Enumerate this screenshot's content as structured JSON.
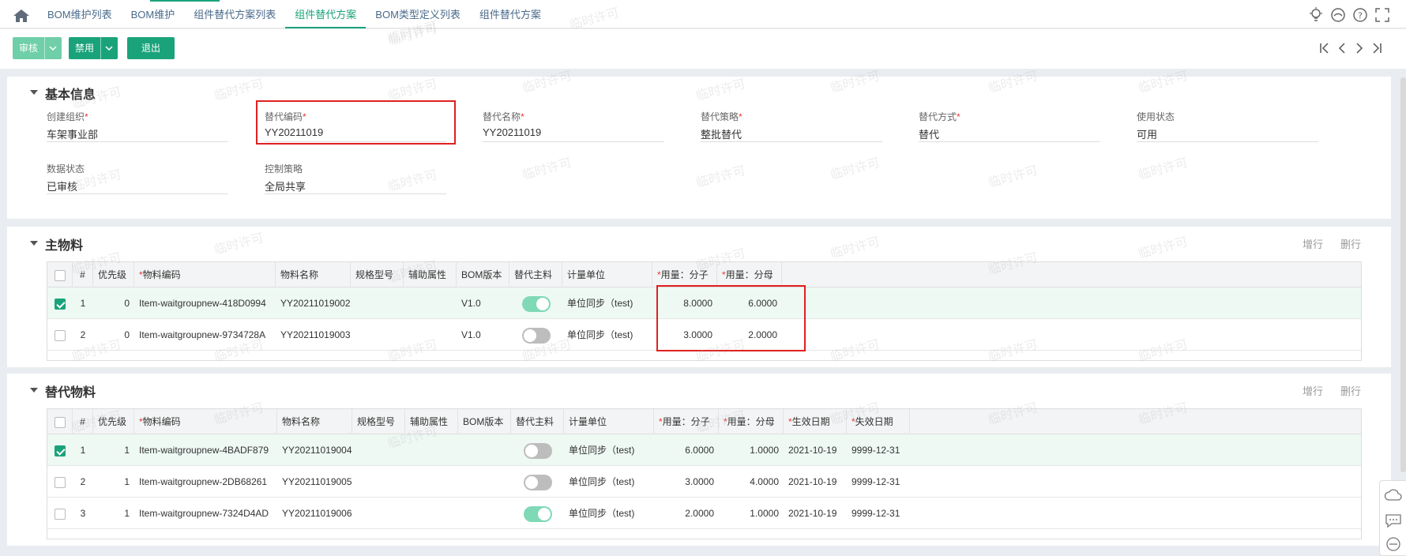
{
  "tabs": [
    {
      "label": "BOM维护列表",
      "active": false
    },
    {
      "label": "BOM维护",
      "active": false
    },
    {
      "label": "组件替代方案列表",
      "active": false
    },
    {
      "label": "组件替代方案",
      "active": true
    },
    {
      "label": "BOM类型定义列表",
      "active": false
    },
    {
      "label": "组件替代方案",
      "active": false
    }
  ],
  "toolbar": {
    "approve": "审核",
    "disable": "禁用",
    "exit": "退出"
  },
  "basic": {
    "title": "基本信息",
    "fields": [
      {
        "label": "创建组织",
        "required": true,
        "value": "车架事业部"
      },
      {
        "label": "替代编码",
        "required": true,
        "value": "YY20211019"
      },
      {
        "label": "替代名称",
        "required": true,
        "value": "YY20211019"
      },
      {
        "label": "替代策略",
        "required": true,
        "value": "整批替代"
      },
      {
        "label": "替代方式",
        "required": true,
        "value": "替代"
      },
      {
        "label": "使用状态",
        "required": false,
        "value": "可用"
      },
      {
        "label": "数据状态",
        "required": false,
        "value": "已审核"
      },
      {
        "label": "控制策略",
        "required": false,
        "value": "全局共享"
      }
    ]
  },
  "main": {
    "title": "主物料",
    "add_row": "增行",
    "del_row": "删行",
    "columns": {
      "no": "#",
      "priority": "优先级",
      "code": "物料编码",
      "name": "物料名称",
      "spec": "规格型号",
      "attr": "辅助属性",
      "bom": "BOM版本",
      "primary": "替代主料",
      "unit": "计量单位",
      "num": "用量：分子",
      "den": "用量：分母"
    },
    "rows": [
      {
        "checked": true,
        "no": "1",
        "priority": "0",
        "code": "Item-waitgroupnew-418D0994",
        "name": "YY20211019002",
        "spec": "",
        "attr": "",
        "bom": "V1.0",
        "primary": true,
        "unit": "单位同步（test)",
        "num": "8.0000",
        "den": "6.0000"
      },
      {
        "checked": false,
        "no": "2",
        "priority": "0",
        "code": "Item-waitgroupnew-9734728A",
        "name": "YY20211019003",
        "spec": "",
        "attr": "",
        "bom": "V1.0",
        "primary": false,
        "unit": "单位同步（test)",
        "num": "3.0000",
        "den": "2.0000"
      }
    ]
  },
  "sub": {
    "title": "替代物料",
    "add_row": "增行",
    "del_row": "删行",
    "columns": {
      "no": "#",
      "priority": "优先级",
      "code": "物料编码",
      "name": "物料名称",
      "spec": "规格型号",
      "attr": "辅助属性",
      "bom": "BOM版本",
      "primary": "替代主料",
      "unit": "计量单位",
      "num": "用量：分子",
      "den": "用量：分母",
      "start": "生效日期",
      "end": "失效日期"
    },
    "rows": [
      {
        "checked": true,
        "no": "1",
        "priority": "1",
        "code": "Item-waitgroupnew-4BADF879",
        "name": "YY20211019004",
        "spec": "",
        "attr": "",
        "bom": "",
        "primary": false,
        "unit": "单位同步（test)",
        "num": "6.0000",
        "den": "1.0000",
        "start": "2021-10-19",
        "end": "9999-12-31"
      },
      {
        "checked": false,
        "no": "2",
        "priority": "1",
        "code": "Item-waitgroupnew-2DB68261",
        "name": "YY20211019005",
        "spec": "",
        "attr": "",
        "bom": "",
        "primary": false,
        "unit": "单位同步（test)",
        "num": "3.0000",
        "den": "4.0000",
        "start": "2021-10-19",
        "end": "9999-12-31"
      },
      {
        "checked": false,
        "no": "3",
        "priority": "1",
        "code": "Item-waitgroupnew-7324D4AD",
        "name": "YY20211019006",
        "spec": "",
        "attr": "",
        "bom": "",
        "primary": true,
        "unit": "单位同步（test)",
        "num": "2.0000",
        "den": "1.0000",
        "start": "2021-10-19",
        "end": "9999-12-31"
      }
    ]
  },
  "watermark": "临时许可",
  "colors": {
    "accent": "#1aa37a",
    "approve_btn": "#6fcfa8",
    "highlight_box": "#e02020"
  },
  "icons": [
    "home-icon",
    "bulb-icon",
    "minus-circle-icon",
    "help-icon",
    "fullscreen-icon",
    "first-page-icon",
    "prev-page-icon",
    "next-page-icon",
    "last-page-icon",
    "cloud-icon",
    "chat-icon"
  ]
}
